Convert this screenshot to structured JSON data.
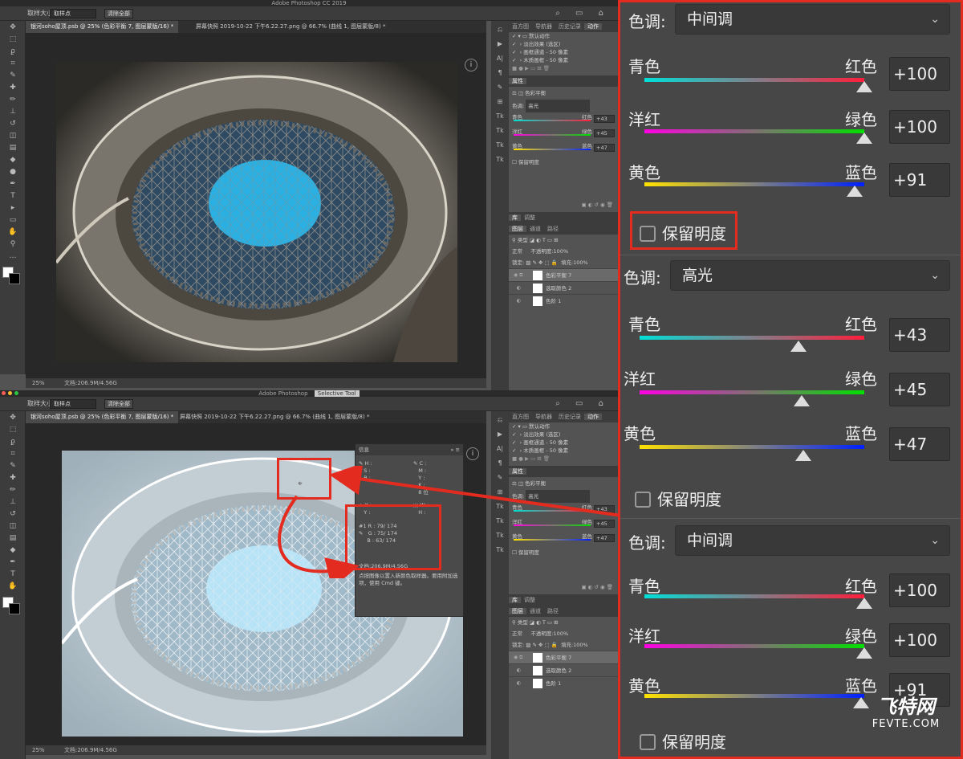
{
  "app": {
    "title": "Adobe Photoshop CC 2019",
    "title2": "Adobe Photoshop",
    "selective_tool": "Selective Tool"
  },
  "options_bar": {
    "sample_size_label": "取样大小:",
    "sample_value": "取样点",
    "clear_all": "清除全部"
  },
  "doc_tabs": [
    {
      "label": "银河soho屋顶.psb @ 25% (色彩平衡 7, 图层蒙版/16) *"
    },
    {
      "label": "屏幕快照 2019-10-22 下午6.22.27.png @ 66.7% (曲线 1, 图层蒙版/8) *"
    }
  ],
  "status": {
    "zoom": "25%",
    "doc": "文档:206.9M/4.56G"
  },
  "panel_tabs_top": [
    "直方图",
    "导航器",
    "历史记录",
    "动作"
  ],
  "actions": [
    "默认动作",
    "淡出效果 (选区)",
    "画框通道 - 50 像素",
    "木质画框 - 50 像素"
  ],
  "properties": {
    "tab": "属性",
    "title": "色彩平衡",
    "tone_label": "色调:",
    "tone": "高光",
    "rows": [
      {
        "left": "青色",
        "right": "红色",
        "value": "+43"
      },
      {
        "left": "洋红",
        "right": "绿色",
        "value": "+45"
      },
      {
        "left": "黄色",
        "right": "蓝色",
        "value": "+47"
      }
    ],
    "preserve": "保留明度"
  },
  "lib_tabs": [
    "库",
    "调整"
  ],
  "layer_tabs": [
    "图层",
    "通道",
    "路径"
  ],
  "layers_panel": {
    "kind": "类型",
    "blend": "正常",
    "opacity_label": "不透明度:",
    "opacity": "100%",
    "lock_label": "锁定:",
    "fill_label": "填充:",
    "fill": "100%",
    "layers": [
      "色彩平衡 7",
      "选取颜色 2",
      "色阶 1"
    ]
  },
  "info_panel": {
    "title": "信息",
    "hsb": [
      "H :",
      "S :",
      "B :"
    ],
    "cmyk": [
      "C :",
      "M :",
      "Y :",
      "K :"
    ],
    "bit": "8 位",
    "xy": [
      "X :",
      "Y :"
    ],
    "wh": [
      "W :",
      "H :"
    ],
    "sample": [
      {
        "label": "R :",
        "value": "79/ 174"
      },
      {
        "label": "G :",
        "value": "75/ 174"
      },
      {
        "label": "B :",
        "value": "63/ 174"
      }
    ],
    "sample_id": "#1",
    "doc": "文档:206.9M/4.56G",
    "hint": "点按图像以置入新颜色取样器。要用附加选项，使用 Cmd 键。"
  },
  "right_panel": {
    "tone_label": "色调:",
    "sections": [
      {
        "tone": "中间调",
        "rows": [
          {
            "left": "青色",
            "right": "红色",
            "value": "+100"
          },
          {
            "left": "洋红",
            "right": "绿色",
            "value": "+100"
          },
          {
            "left": "黄色",
            "right": "蓝色",
            "value": "+91"
          }
        ],
        "preserve": "保留明度"
      },
      {
        "tone": "高光",
        "rows": [
          {
            "left": "青色",
            "right": "红色",
            "value": "+43"
          },
          {
            "left": "洋红",
            "right": "绿色",
            "value": "+45"
          },
          {
            "left": "黄色",
            "right": "蓝色",
            "value": "+47"
          }
        ],
        "preserve": "保留明度"
      },
      {
        "tone": "中间调",
        "rows": [
          {
            "left": "青色",
            "right": "红色",
            "value": "+100"
          },
          {
            "left": "洋红",
            "right": "绿色",
            "value": "+100"
          },
          {
            "left": "黄色",
            "right": "蓝色",
            "value": "+91"
          }
        ],
        "preserve": "保留明度"
      }
    ]
  },
  "watermark": {
    "logo": "飞特网",
    "url": "FEVTE.COM"
  },
  "colors": {
    "accent_red": "#e42b1f",
    "sky_blue": "#2bb0e0"
  }
}
